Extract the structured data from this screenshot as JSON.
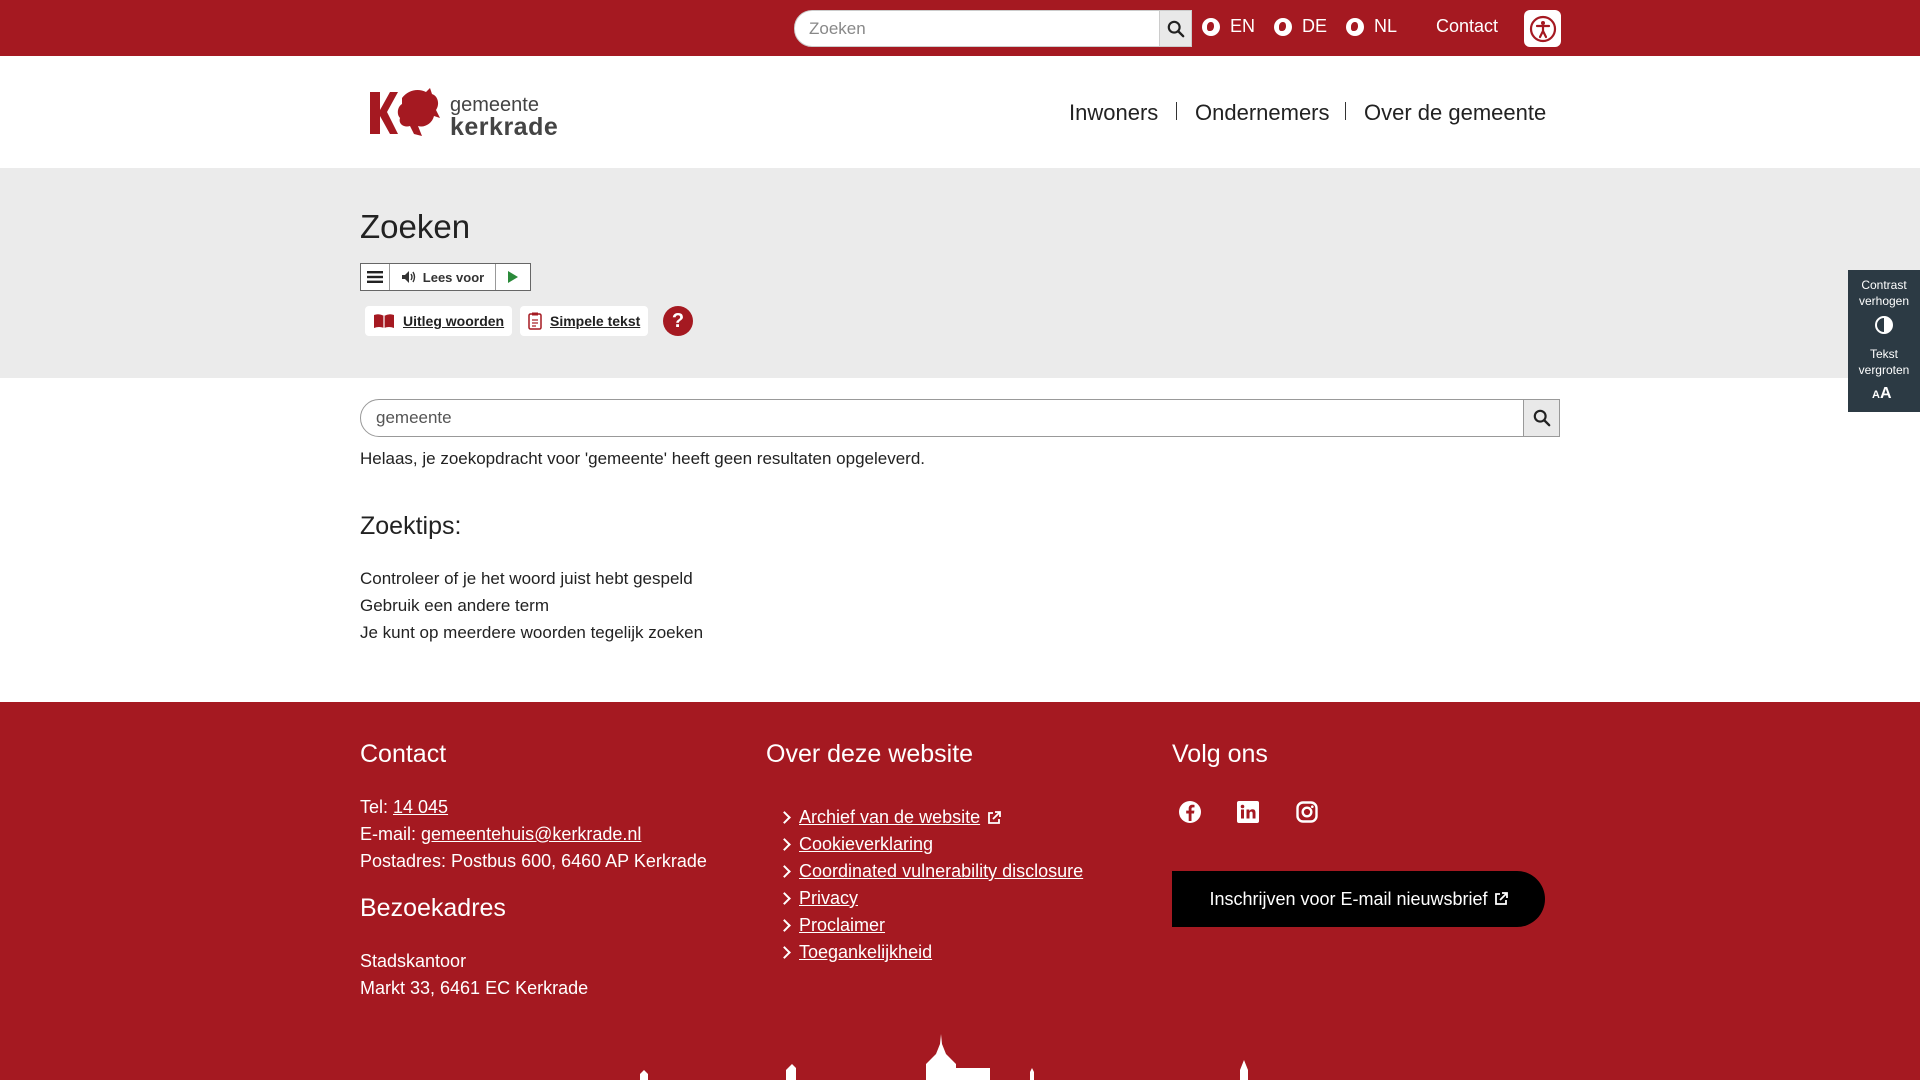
{
  "topbar": {
    "search_placeholder": "Zoeken",
    "languages": [
      "EN",
      "DE",
      "NL"
    ],
    "contact": "Contact"
  },
  "header": {
    "logo_line1": "gemeente",
    "logo_line2": "kerkrade",
    "nav": [
      "Inwoners",
      "Ondernemers",
      "Over de gemeente"
    ]
  },
  "page": {
    "title": "Zoeken",
    "readspeaker_label": "Lees voor",
    "tool_glossary": "Uitleg woorden",
    "tool_simple": "Simpele tekst",
    "help": "?"
  },
  "side_panel": {
    "contrast": "Contrast verhogen",
    "text_size": "Tekst vergroten"
  },
  "search": {
    "query": "gemeente",
    "no_results": "Helaas, je zoekopdracht voor 'gemeente' heeft geen resultaten opgeleverd.",
    "tips_title": "Zoektips:",
    "tips": [
      "Controleer of je het woord juist hebt gespeld",
      "Gebruik een andere term",
      "Je kunt op meerdere woorden tegelijk zoeken"
    ]
  },
  "footer": {
    "contact_title": "Contact",
    "tel_label": "Tel: ",
    "tel": "14 045",
    "email_label": "E-mail: ",
    "email": "gemeentehuis@kerkrade.nl",
    "postal": "Postadres: Postbus 600, 6460 AP Kerkrade",
    "visit_title": "Bezoekadres",
    "visit_line1": "Stadskantoor",
    "visit_line2": "Markt 33, 6461 EC Kerkrade",
    "site_title": "Over deze website",
    "links": [
      "Archief van de website",
      "Cookieverklaring",
      "Coordinated vulnerability disclosure",
      "Privacy",
      "Proclaimer",
      "Toegankelijkheid"
    ],
    "follow_title": "Volg ons",
    "social": [
      "facebook-icon",
      "linkedin-icon",
      "instagram-icon"
    ],
    "newsletter": "Inschrijven voor E-mail nieuwsbrief"
  },
  "colors": {
    "brand_red": "#a51921",
    "band_grey": "#ebebeb",
    "side_panel": "#2c3a44"
  }
}
